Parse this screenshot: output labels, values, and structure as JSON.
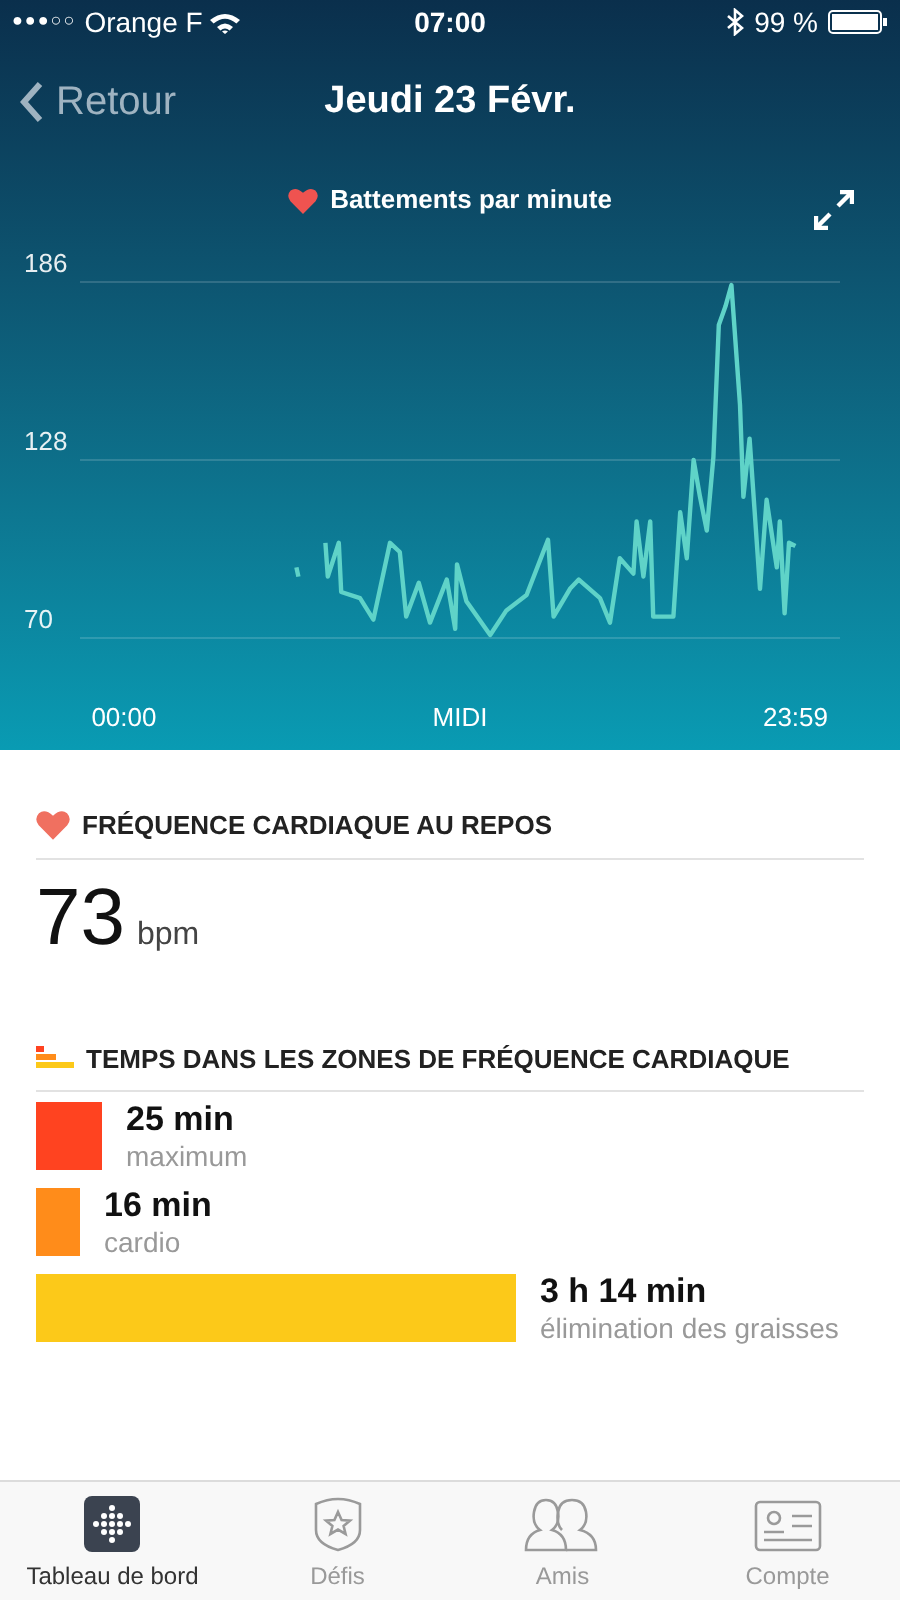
{
  "status_bar": {
    "signal": "●●●○○",
    "carrier": "Orange F",
    "time": "07:00",
    "battery": "99 %"
  },
  "nav": {
    "back": "Retour",
    "title": "Jeudi 23 Févr."
  },
  "chart": {
    "chart_data": {
      "type": "line",
      "x": [
        6.16,
        6.23,
        null,
        7.19,
        7.28,
        7.67,
        7.76,
        8.43,
        8.91,
        9.5,
        9.85,
        10.08,
        10.53,
        10.93,
        11.53,
        11.83,
        11.89,
        12.23,
        13.08,
        13.66,
        14.38,
        15.14,
        15.34,
        15.93,
        16.24,
        17.0,
        17.36,
        17.71,
        18.19,
        18.31,
        18.55,
        18.79,
        18.9,
        19.62,
        19.86,
        20.1,
        20.34,
        20.57,
        20.81,
        21.05,
        21.24,
        21.48,
        21.69,
        22.0,
        22.12,
        22.34,
        22.71,
        22.95,
        23.31,
        23.42,
        23.59,
        23.75,
        23.98
      ],
      "series": [
        {
          "name": "Battements par minute",
          "color": "#5fd3c8",
          "values": [
            93,
            90,
            null,
            101,
            90,
            101,
            85,
            83,
            76,
            101,
            98,
            77,
            88,
            75,
            89,
            73,
            94,
            82,
            71,
            79,
            84,
            102,
            77,
            86,
            89,
            83,
            75,
            96,
            91,
            108,
            90,
            108,
            77,
            77,
            111,
            96,
            128,
            116,
            105,
            129,
            172,
            178,
            185,
            146,
            116,
            135,
            86,
            115,
            93,
            108,
            78,
            101,
            100
          ]
        }
      ],
      "ylim": [
        70,
        186
      ],
      "yticks": [
        70,
        128,
        186
      ],
      "xlim": [
        -1.57,
        25.57
      ],
      "xticks": [
        {
          "value": 0,
          "label": "00:00"
        },
        {
          "value": 12,
          "label": "MIDI"
        },
        {
          "value": 23.98,
          "label": "23:59"
        }
      ]
    }
  },
  "resting": {
    "heading": "FRÉQUENCE CARDIAQUE AU REPOS",
    "value": "73",
    "unit": "bpm"
  },
  "zones": {
    "heading": "TEMPS DANS LES ZONES DE FRÉQUENCE CARDIAQUE",
    "items": [
      {
        "time": "25 min",
        "label": "maximum",
        "color": "#ff4320"
      },
      {
        "time": "16 min",
        "label": "cardio",
        "color": "#ff8c1a"
      },
      {
        "time": "3 h 14 min",
        "label": "élimination des graisses",
        "color": "#fcc919"
      }
    ]
  },
  "tab_bar": [
    {
      "label": "Tableau de bord",
      "selected": true
    },
    {
      "label": "Défis",
      "selected": false
    },
    {
      "label": "Amis",
      "selected": false
    },
    {
      "label": "Compte",
      "selected": false
    }
  ]
}
